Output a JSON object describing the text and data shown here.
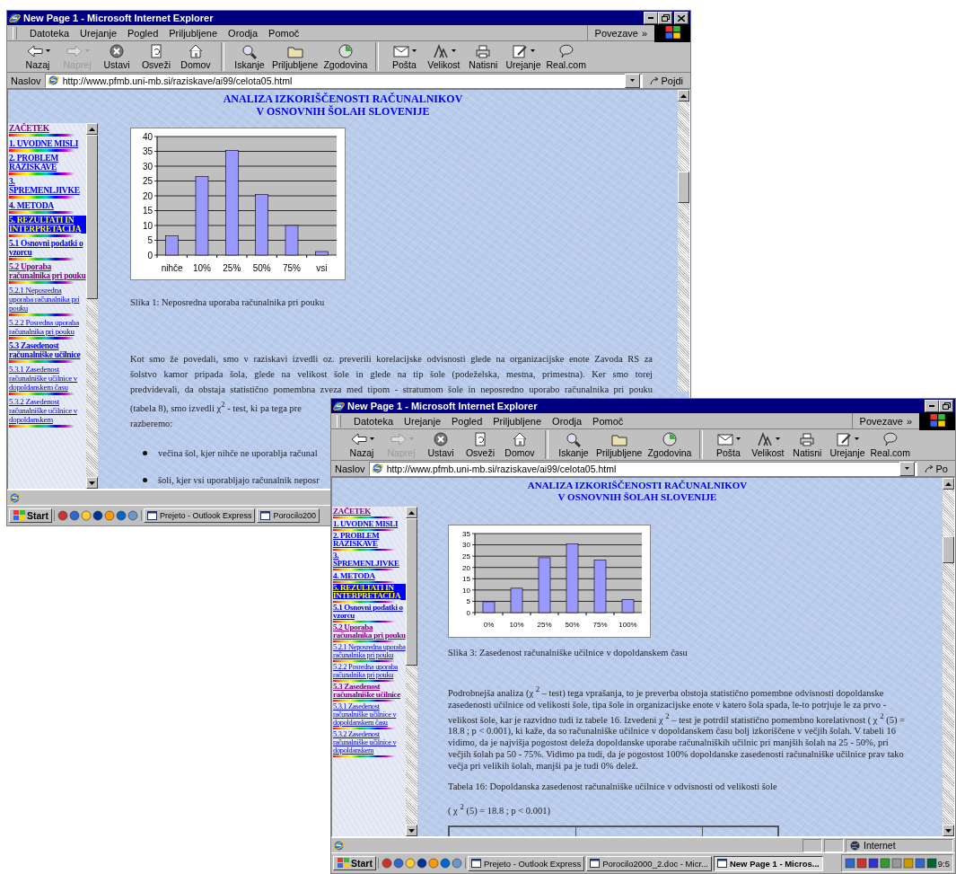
{
  "windows": [
    {
      "title": "New Page 1 - Microsoft Internet Explorer",
      "window_controls": [
        {
          "kind": "minimize"
        },
        {
          "kind": "maximize"
        },
        {
          "kind": "close"
        }
      ],
      "menu": [
        "Datoteka",
        "Urejanje",
        "Pogled",
        "Priljubljene",
        "Orodja",
        "Pomoč"
      ],
      "links": "Povezave",
      "links_chevron": "»",
      "toolbar": [
        [
          {
            "label": "Nazaj",
            "disabled": false,
            "dropdown": true
          },
          {
            "label": "Naprej",
            "disabled": true,
            "dropdown": true
          },
          {
            "label": "Ustavi",
            "disabled": false,
            "dropdown": false
          },
          {
            "label": "Osveži",
            "disabled": false,
            "dropdown": false
          },
          {
            "label": "Domov",
            "disabled": false,
            "dropdown": false
          }
        ],
        [
          {
            "label": "Iskanje",
            "disabled": false,
            "dropdown": false
          },
          {
            "label": "Priljubljene",
            "disabled": false,
            "dropdown": false
          },
          {
            "label": "Zgodovina",
            "disabled": false,
            "dropdown": false
          }
        ],
        [
          {
            "label": "Pošta",
            "disabled": false,
            "dropdown": true
          },
          {
            "label": "Velikost",
            "disabled": false,
            "dropdown": true
          },
          {
            "label": "Natisni",
            "disabled": false,
            "dropdown": false
          },
          {
            "label": "Urejanje",
            "disabled": false,
            "dropdown": true
          },
          {
            "label": "Real.com",
            "disabled": false,
            "dropdown": false
          }
        ]
      ],
      "address": {
        "label": "Naslov",
        "url": "http://www.pfmb.uni-mb.si/raziskave/ai99/celota05.html",
        "go": "Pojdi"
      },
      "page": {
        "heading": [
          "ANALIZA IZKORIŠČENOSTI RAČUNALNIKOV",
          "V OSNOVNIH ŠOLAH SLOVENIJE"
        ],
        "nav": [
          {
            "text": "ZAČETEK",
            "kind": "chapter",
            "visited": true,
            "selected": false
          },
          {
            "text": "1. UVODNE MISLI",
            "kind": "chapter",
            "visited": false,
            "selected": false
          },
          {
            "text": "2. PROBLEM RAZISKAVE",
            "kind": "chapter",
            "visited": false,
            "selected": false
          },
          {
            "text": "3. SPREMENLJIVKE",
            "kind": "chapter",
            "visited": false,
            "selected": false
          },
          {
            "text": "4. METODA",
            "kind": "chapter",
            "visited": false,
            "selected": false
          },
          {
            "text": "5. REZULTATI IN INTERPRETACIJA",
            "kind": "chapter",
            "visited": false,
            "selected": true
          },
          {
            "text": "5.1 Osnovni podatki o vzorcu",
            "kind": "section",
            "visited": false,
            "selected": false
          },
          {
            "text": "5.2 Uporaba računalnika pri pouku",
            "kind": "section",
            "visited": true,
            "selected": false
          },
          {
            "text": "5.2.1 Neposredna uporaba računalnika pri pouku",
            "kind": "subsection",
            "visited": false,
            "selected": false
          },
          {
            "text": "5.2.2 Posredna uporaba računalnika pri pouku",
            "kind": "subsection",
            "visited": false,
            "selected": false
          },
          {
            "text": "5.3 Zasedenost računalniške učilnice",
            "kind": "section",
            "visited": false,
            "selected": false
          },
          {
            "text": "5.3.1 Zasedenost računalniške učilnice v dopoldanskem času",
            "kind": "subsection",
            "visited": false,
            "selected": false
          },
          {
            "text": "5.3.2 Zasedenost računalniške učilnice v dopoldanskem",
            "kind": "subsection",
            "visited": false,
            "selected": false
          }
        ],
        "blocks": [
          {
            "kind": "chart",
            "chart_data": {
              "type": "bar",
              "categories": [
                "nihče",
                "10%",
                "25%",
                "50%",
                "75%",
                "vsi"
              ],
              "grid": true,
              "series": [
                {
                  "color": "#9999ff",
                  "values": [
                    6.5,
                    26.5,
                    35.3,
                    20.5,
                    10,
                    1.2
                  ]
                }
              ],
              "ylim": [
                0,
                40
              ],
              "yticks": [
                0,
                5,
                10,
                15,
                20,
                25,
                30,
                35,
                40
              ]
            }
          },
          {
            "kind": "caption",
            "text": "Slika 1: Neposredna uporaba računalnika pri pouku"
          },
          {
            "kind": "lines",
            "lines": [
              {
                "text": "Kot smo že povedali, smo v raziskavi izvedli oz. preverili korelacijske odvisnosti glede na organizacijske enote Zavoda RS za",
                "justified": true
              },
              {
                "text": "šolstvo kamor pripada šola, glede na velikost šole in glede na  tip šole (podeželska, mestna, primestna). Ker smo torej",
                "justified": true
              },
              {
                "text": "predvidevali, da obstaja statistično pomembna zveza med tipom - stratumom šole in neposredno uporabo računalnika pri pouku",
                "justified": true
              }
            ]
          },
          {
            "kind": "lines",
            "lines": [
              {
                "text": "(tabela 8), smo izvedli χ$^{2}$ - test, ki pa tega pre"
              },
              {
                "text": "razberemo:"
              }
            ]
          },
          {
            "kind": "bullets",
            "items": [
              "večina šol, kjer nihče ne uporablja računal",
              "šoli, kjer vsi uporabljajo računalnik neposr"
            ]
          }
        ]
      },
      "taskbar": {
        "start": "Start",
        "tasks": [
          {
            "label": "Prejeto - Outlook Express",
            "selected": false
          },
          {
            "label": "Porocilo200",
            "selected": false
          }
        ]
      }
    },
    {
      "title": "New Page 1 - Microsoft Internet Explorer",
      "window_controls": [
        {
          "kind": "minimize"
        },
        {
          "kind": "maximize"
        }
      ],
      "menu": [
        "Datoteka",
        "Urejanje",
        "Pogled",
        "Priljubljene",
        "Orodja",
        "Pomoč"
      ],
      "links": "Povezave",
      "links_chevron": "»",
      "toolbar": [
        [
          {
            "label": "Nazaj",
            "disabled": false,
            "dropdown": true
          },
          {
            "label": "Naprej",
            "disabled": true,
            "dropdown": true
          },
          {
            "label": "Ustavi",
            "disabled": false,
            "dropdown": false
          },
          {
            "label": "Osveži",
            "disabled": false,
            "dropdown": false
          },
          {
            "label": "Domov",
            "disabled": false,
            "dropdown": false
          }
        ],
        [
          {
            "label": "Iskanje",
            "disabled": false,
            "dropdown": false
          },
          {
            "label": "Priljubljene",
            "disabled": false,
            "dropdown": false
          },
          {
            "label": "Zgodovina",
            "disabled": false,
            "dropdown": false
          }
        ],
        [
          {
            "label": "Pošta",
            "disabled": false,
            "dropdown": true
          },
          {
            "label": "Velikost",
            "disabled": false,
            "dropdown": true
          },
          {
            "label": "Natisni",
            "disabled": false,
            "dropdown": false
          },
          {
            "label": "Urejanje",
            "disabled": false,
            "dropdown": true
          },
          {
            "label": "Real.com",
            "disabled": false,
            "dropdown": false
          }
        ]
      ],
      "address": {
        "label": "Naslov",
        "url": "http://www.pfmb.uni-mb.si/raziskave/ai99/celota05.html",
        "go": "Po"
      },
      "page": {
        "heading": [
          "ANALIZA IZKORIŠČENOSTI RAČUNALNIKOV",
          "V OSNOVNIH ŠOLAH SLOVENIJE"
        ],
        "nav": [
          {
            "text": "ZAČETEK",
            "kind": "chapter",
            "visited": true,
            "selected": false
          },
          {
            "text": "1. UVODNE MISLI",
            "kind": "chapter",
            "visited": false,
            "selected": false
          },
          {
            "text": "2. PROBLEM RAZISKAVE",
            "kind": "chapter",
            "visited": false,
            "selected": false
          },
          {
            "text": "3. SPREMENLJIVKE",
            "kind": "chapter",
            "visited": false,
            "selected": false
          },
          {
            "text": "4. METODA",
            "kind": "chapter",
            "visited": false,
            "selected": false
          },
          {
            "text": "5. REZULTATI IN INTERPRETACIJA",
            "kind": "chapter",
            "visited": false,
            "selected": true
          },
          {
            "text": "5.1 Osnovni podatki o vzorcu",
            "kind": "section",
            "visited": false,
            "selected": false
          },
          {
            "text": "5.2 Uporaba računalnika pri pouku",
            "kind": "section",
            "visited": true,
            "selected": false
          },
          {
            "text": "5.2.1 Neposredna uporaba računalnika pri pouku",
            "kind": "subsection",
            "visited": false,
            "selected": false
          },
          {
            "text": "5.2.2 Posredna uporaba računalnika pri pouku",
            "kind": "subsection",
            "visited": false,
            "selected": false
          },
          {
            "text": "5.3 Zasedenost računalniške učilnice",
            "kind": "section",
            "visited": true,
            "selected": false
          },
          {
            "text": "5.3.1 Zasedenost računalniške učilnice v dopoldanskem času",
            "kind": "subsection",
            "visited": false,
            "selected": false
          },
          {
            "text": "5.3.2 Zasedenost računalniške učilnice v dopoldanskem",
            "kind": "subsection",
            "visited": false,
            "selected": false
          }
        ],
        "blocks": [
          {
            "kind": "chart",
            "chart_data": {
              "type": "bar",
              "categories": [
                "0%",
                "10%",
                "25%",
                "50%",
                "75%",
                "100%"
              ],
              "grid": true,
              "series": [
                {
                  "color": "#9999ff",
                  "values": [
                    4.8,
                    10.8,
                    24.3,
                    30.4,
                    23.2,
                    5.8
                  ]
                }
              ],
              "ylim": [
                0,
                35
              ],
              "yticks": [
                0,
                5,
                10,
                15,
                20,
                25,
                30,
                35
              ]
            }
          },
          {
            "kind": "caption",
            "text": "Slika 3: Zasedenost računalniške učilnice v dopoldanskem času"
          },
          {
            "kind": "paragraph",
            "text": "Podrobnejša analiza (χ $^{2}$ – test) tega vprašanja, to je preverba obstoja statistično pomembne odvisnosti dopoldanske zasedenosti učilnice od velikosti šole, tipa šole in organizacijske enote v katero šola spada, le-to potrjuje le za prvo - velikost šole, kar je razvidno tudi iz tabele 16. Izvedeni χ $^{2}$ – test je potrdil statistično pomembno korelativnost ( χ $^{2}$ (5) = 18.8 ; p < 0.001), ki kaže, da so računalniške učilnice v dopoldanskem času bolj izkoriščene v večjih šolah. V tabeli 16 vidimo, da je najvišja pogostost deleža dopoldanske uporabe računalniških učilnic pri manjših šolah na 25 - 50%, pri večjih šolah pa 50 - 75%. Vidimo pa tudi, da je pogostost 100% dopoldanske zasedenosti računalniške učilnice prav tako večja pri velikih šolah, manjši pa je tudi 0% delež."
          },
          {
            "kind": "caption",
            "text": "Tabela 16: Dopoldanska zasedenost računalniške učilnice v odvisnosti od velikosti šole"
          },
          {
            "kind": "caption",
            "text": "( χ $^{2}$ (5) = 18.8 ; p < 0.001)"
          },
          {
            "kind": "table"
          }
        ]
      },
      "status": {
        "zone": "Internet"
      },
      "taskbar": {
        "start": "Start",
        "tasks": [
          {
            "label": "Prejeto - Outlook Express",
            "selected": false
          },
          {
            "label": "Porocilo2000_2.doc - Micr...",
            "selected": false
          },
          {
            "label": "New Page 1 - Micros...",
            "selected": true
          }
        ],
        "clock": "9:5"
      }
    }
  ]
}
